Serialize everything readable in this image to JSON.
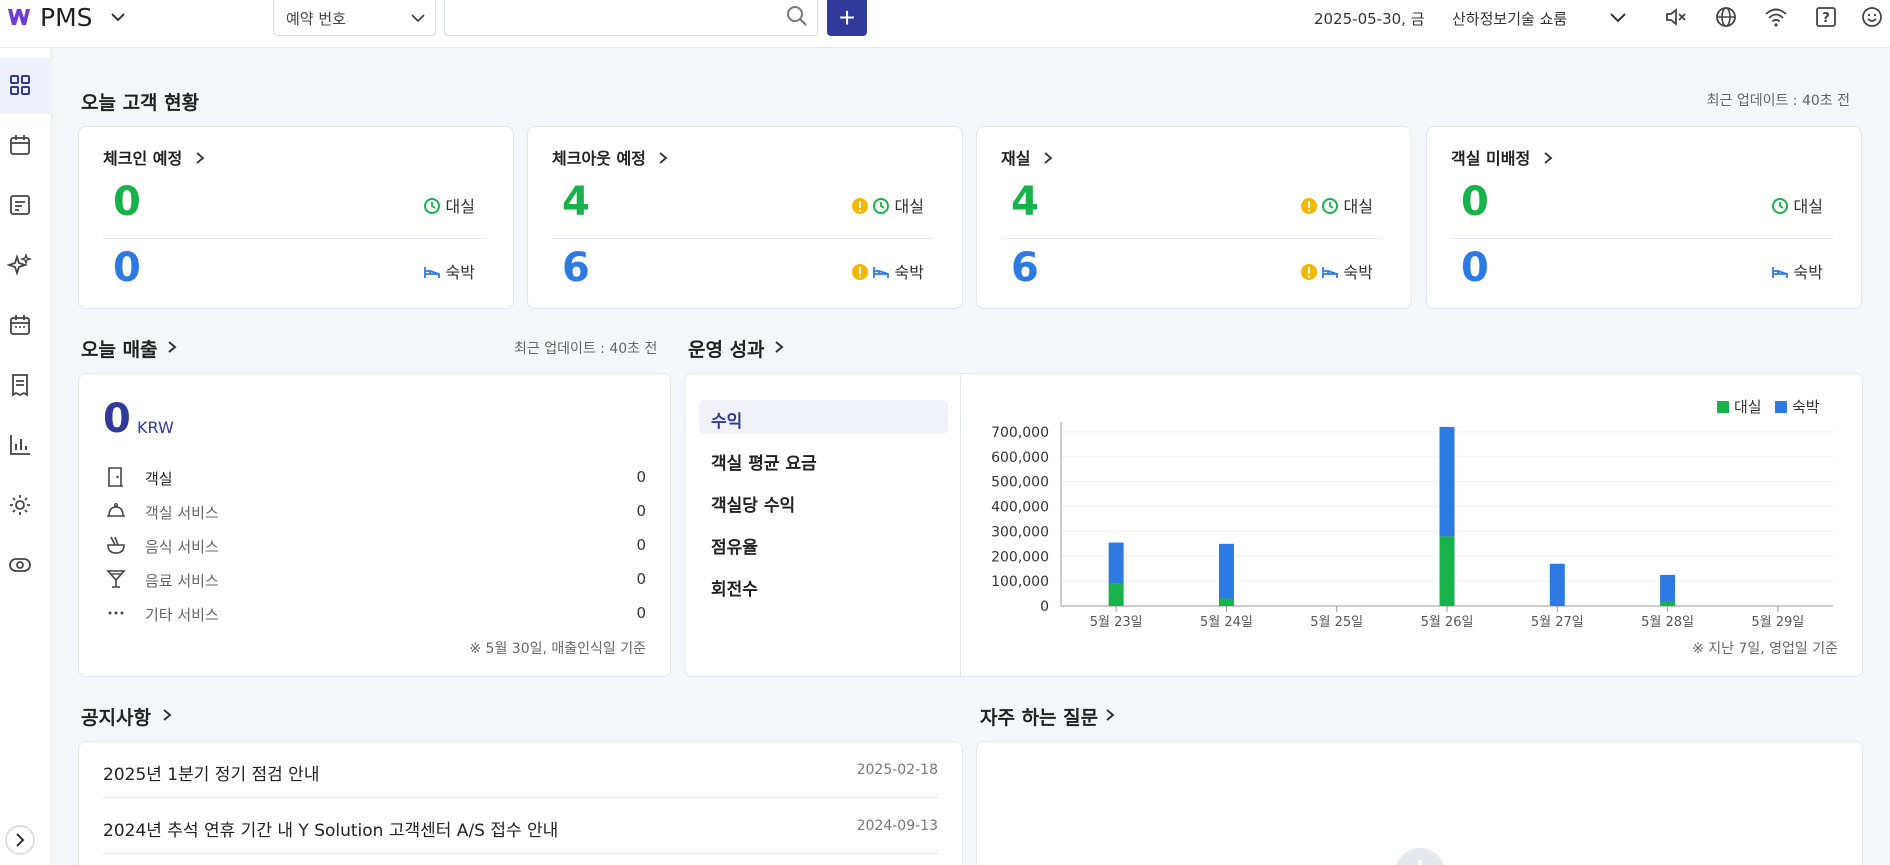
{
  "topbar": {
    "brand": "PMS",
    "search_type": "예약 번호",
    "search_placeholder": "",
    "add_label": "+",
    "date": "2025-05-30, 금",
    "hotel": "산하정보기술 쇼룸"
  },
  "overview": {
    "title": "오늘 고객 현황",
    "updated": "최근 업데이트 : 40초 전",
    "cards": [
      {
        "title": "체크인 예정",
        "top_value": "0",
        "top_label": "대실",
        "bottom_value": "0",
        "bottom_label": "숙박",
        "warning": false
      },
      {
        "title": "체크아웃 예정",
        "top_value": "4",
        "top_label": "대실",
        "bottom_value": "6",
        "bottom_label": "숙박",
        "warning": true
      },
      {
        "title": "재실",
        "top_value": "4",
        "top_label": "대실",
        "bottom_value": "6",
        "bottom_label": "숙박",
        "warning": true
      },
      {
        "title": "객실 미배정",
        "top_value": "0",
        "top_label": "대실",
        "bottom_value": "0",
        "bottom_label": "숙박",
        "warning": false
      }
    ]
  },
  "revenue": {
    "title": "오늘 매출",
    "updated": "최근 업데이트 : 40초 전",
    "total": "0",
    "currency": "KRW",
    "rows": [
      {
        "label": "객실",
        "value": "0",
        "icon": "door-icon"
      },
      {
        "label": "객실 서비스",
        "value": "0",
        "icon": "room-service-icon"
      },
      {
        "label": "음식 서비스",
        "value": "0",
        "icon": "food-icon"
      },
      {
        "label": "음료 서비스",
        "value": "0",
        "icon": "drink-icon"
      },
      {
        "label": "기타 서비스",
        "value": "0",
        "icon": "more-icon"
      }
    ],
    "footnote": "※ 5월 30일, 매출인식일 기준"
  },
  "performance": {
    "title": "운영 성과",
    "menu": [
      "수익",
      "객실 평균 요금",
      "객실당 수익",
      "점유율",
      "회전수"
    ],
    "footnote": "※ 지난 7일, 영업일 기준"
  },
  "chart_data": {
    "type": "bar",
    "stacked": true,
    "categories": [
      "5월 23일",
      "5월 24일",
      "5월 25일",
      "5월 26일",
      "5월 27일",
      "5월 28일",
      "5월 29일"
    ],
    "series": [
      {
        "name": "대실",
        "color": "#17b34a",
        "values": [
          90000,
          30000,
          0,
          280000,
          0,
          20000,
          0
        ]
      },
      {
        "name": "숙박",
        "color": "#2d7be2",
        "values": [
          165000,
          220000,
          0,
          440000,
          170000,
          105000,
          0
        ]
      }
    ],
    "yticks": [
      "0",
      "100,000",
      "200,000",
      "300,000",
      "400,000",
      "500,000",
      "600,000",
      "700,000"
    ],
    "ylim": [
      0,
      780000
    ],
    "legend": "top-right",
    "grid": true
  },
  "notices": {
    "title": "공지사항",
    "items": [
      {
        "title": "2025년 1분기 정기 점검 안내",
        "date": "2025-02-18"
      },
      {
        "title": "2024년 추석 연휴 기간 내 Y Solution 고객센터 A/S 접수 안내",
        "date": "2024-09-13"
      }
    ]
  },
  "faq": {
    "title": "자주 하는 질문"
  }
}
